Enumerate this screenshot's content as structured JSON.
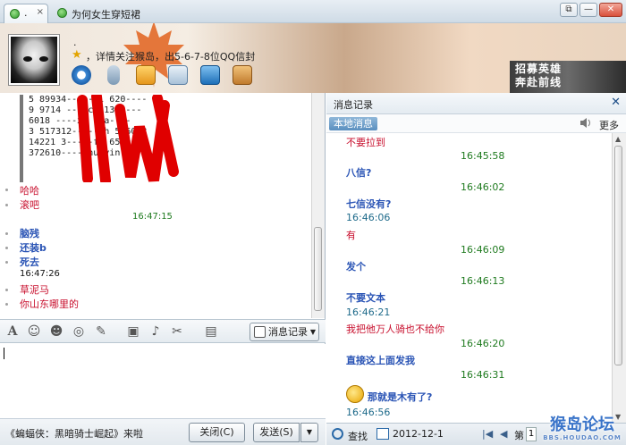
{
  "window": {
    "tabs": [
      {
        "label": "."
      },
      {
        "label": "为何女生穿短裙"
      }
    ],
    "buttons": {
      "restore": "⧉",
      "minimize": "—",
      "close": "✕"
    }
  },
  "header": {
    "nickname": ".",
    "signature": "，详情关注猴岛，出5-6-7-8位QQ信封",
    "toolbar_icons": [
      "video-icon",
      "voice-icon",
      "file-transfer-icon",
      "app-list-icon",
      "remote-desktop-icon",
      "more-apps-icon"
    ],
    "ad": {
      "line1": "招募英雄",
      "line2": "奔赴前线"
    }
  },
  "chat": {
    "image_lines": [
      "5 89934-----hl         620----",
      "  9 9714 ----cl          130----",
      "   6018 ----xi           lma----",
      " 3 517312-----zh       566033",
      "   14221 3-----fa        6589---",
      "   372610-----hu    yin      3"
    ],
    "messages": [
      {
        "text": "哈哈",
        "kind": "red"
      },
      {
        "text": "滚吧",
        "kind": "red"
      },
      {
        "text": "16:47:15",
        "kind": "time"
      },
      {
        "text": "脑残",
        "kind": "blue"
      },
      {
        "text": "还装b",
        "kind": "blue"
      },
      {
        "text": "死去",
        "kind": "blue"
      },
      {
        "text": "16:47:26",
        "kind": "time-left"
      },
      {
        "text": "草泥马",
        "kind": "red"
      },
      {
        "text": "你山东哪里的",
        "kind": "red"
      }
    ]
  },
  "input_toolbar": {
    "icons": [
      "font-icon",
      "emoji-icon",
      "magic-face-icon",
      "shake-icon",
      "handwriting-icon",
      "image-icon",
      "music-icon",
      "screenshot-icon",
      "more-icon"
    ],
    "history_button": "消息记录"
  },
  "bottom": {
    "news": "《蝙蝠侠：黑暗骑士崛起》来啦",
    "close_button": "关闭(C)",
    "send_button": "发送(S)"
  },
  "history": {
    "title": "消息记录",
    "tab": "本地消息",
    "more": "更多",
    "messages": [
      {
        "text": "不要拉到",
        "kind": "red"
      },
      {
        "text": "16:45:58",
        "kind": "time"
      },
      {
        "text": "八信?",
        "kind": "blue"
      },
      {
        "text": "16:46:02",
        "kind": "time"
      },
      {
        "text": "七信没有?",
        "kind": "blue"
      },
      {
        "text": "16:46:06",
        "kind": "time-left"
      },
      {
        "text": "有",
        "kind": "red"
      },
      {
        "text": "16:46:09",
        "kind": "time"
      },
      {
        "text": "发个",
        "kind": "blue"
      },
      {
        "text": "16:46:13",
        "kind": "time"
      },
      {
        "text": "不要文本",
        "kind": "blue"
      },
      {
        "text": "16:46:21",
        "kind": "time-left"
      },
      {
        "text": "我把他万人骑也不给你",
        "kind": "red"
      },
      {
        "text": "16:46:20",
        "kind": "time"
      },
      {
        "text": "直接这上面发我",
        "kind": "blue"
      },
      {
        "text": "16:46:31",
        "kind": "time"
      },
      {
        "text": "那就是木有了?",
        "kind": "blue"
      },
      {
        "text": "16:46:56",
        "kind": "time-left"
      }
    ],
    "footer": {
      "search": "查找",
      "date": "2012-12-1",
      "page_label": "第",
      "page_value": "1"
    }
  },
  "watermark": {
    "text": "猴岛论坛",
    "sub": "BBS.HOUDAO.COM"
  }
}
